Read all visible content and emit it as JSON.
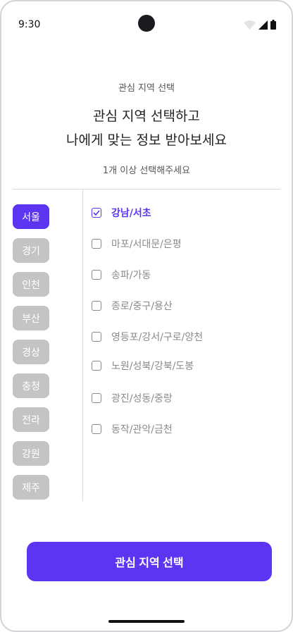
{
  "status_bar": {
    "time": "9:30",
    "icons": [
      "wifi-icon",
      "cellular-signal-icon",
      "battery-icon"
    ]
  },
  "header": {
    "subtitle": "관심 지역 선택",
    "title_line1": "관심 지역 선택하고",
    "title_line2": "나에게 맞는 정보 받아보세요",
    "hint": "1개 이상 선택해주세요"
  },
  "regions": [
    {
      "label": "서울",
      "active": true
    },
    {
      "label": "경기",
      "active": false
    },
    {
      "label": "인천",
      "active": false
    },
    {
      "label": "부산",
      "active": false
    },
    {
      "label": "경상",
      "active": false
    },
    {
      "label": "충청",
      "active": false
    },
    {
      "label": "전라",
      "active": false
    },
    {
      "label": "강원",
      "active": false
    },
    {
      "label": "제주",
      "active": false
    }
  ],
  "districts": [
    {
      "label": "강남/서초",
      "checked": true
    },
    {
      "label": "마포/서대문/은평",
      "checked": false
    },
    {
      "label": "송파/가동",
      "checked": false
    },
    {
      "label": "종로/중구/용산",
      "checked": false
    },
    {
      "label": "영등포/강서/구로/양천",
      "checked": false
    },
    {
      "label": "노원/성북/강북/도봉",
      "checked": false
    },
    {
      "label": "광진/성동/중랑",
      "checked": false
    },
    {
      "label": "동작/관악/금천",
      "checked": false
    }
  ],
  "cta": {
    "label": "관심 지역 선택"
  },
  "colors": {
    "accent": "#5b35f2",
    "chip_inactive": "#c4c4c4",
    "text_muted": "#8a8a8a"
  }
}
